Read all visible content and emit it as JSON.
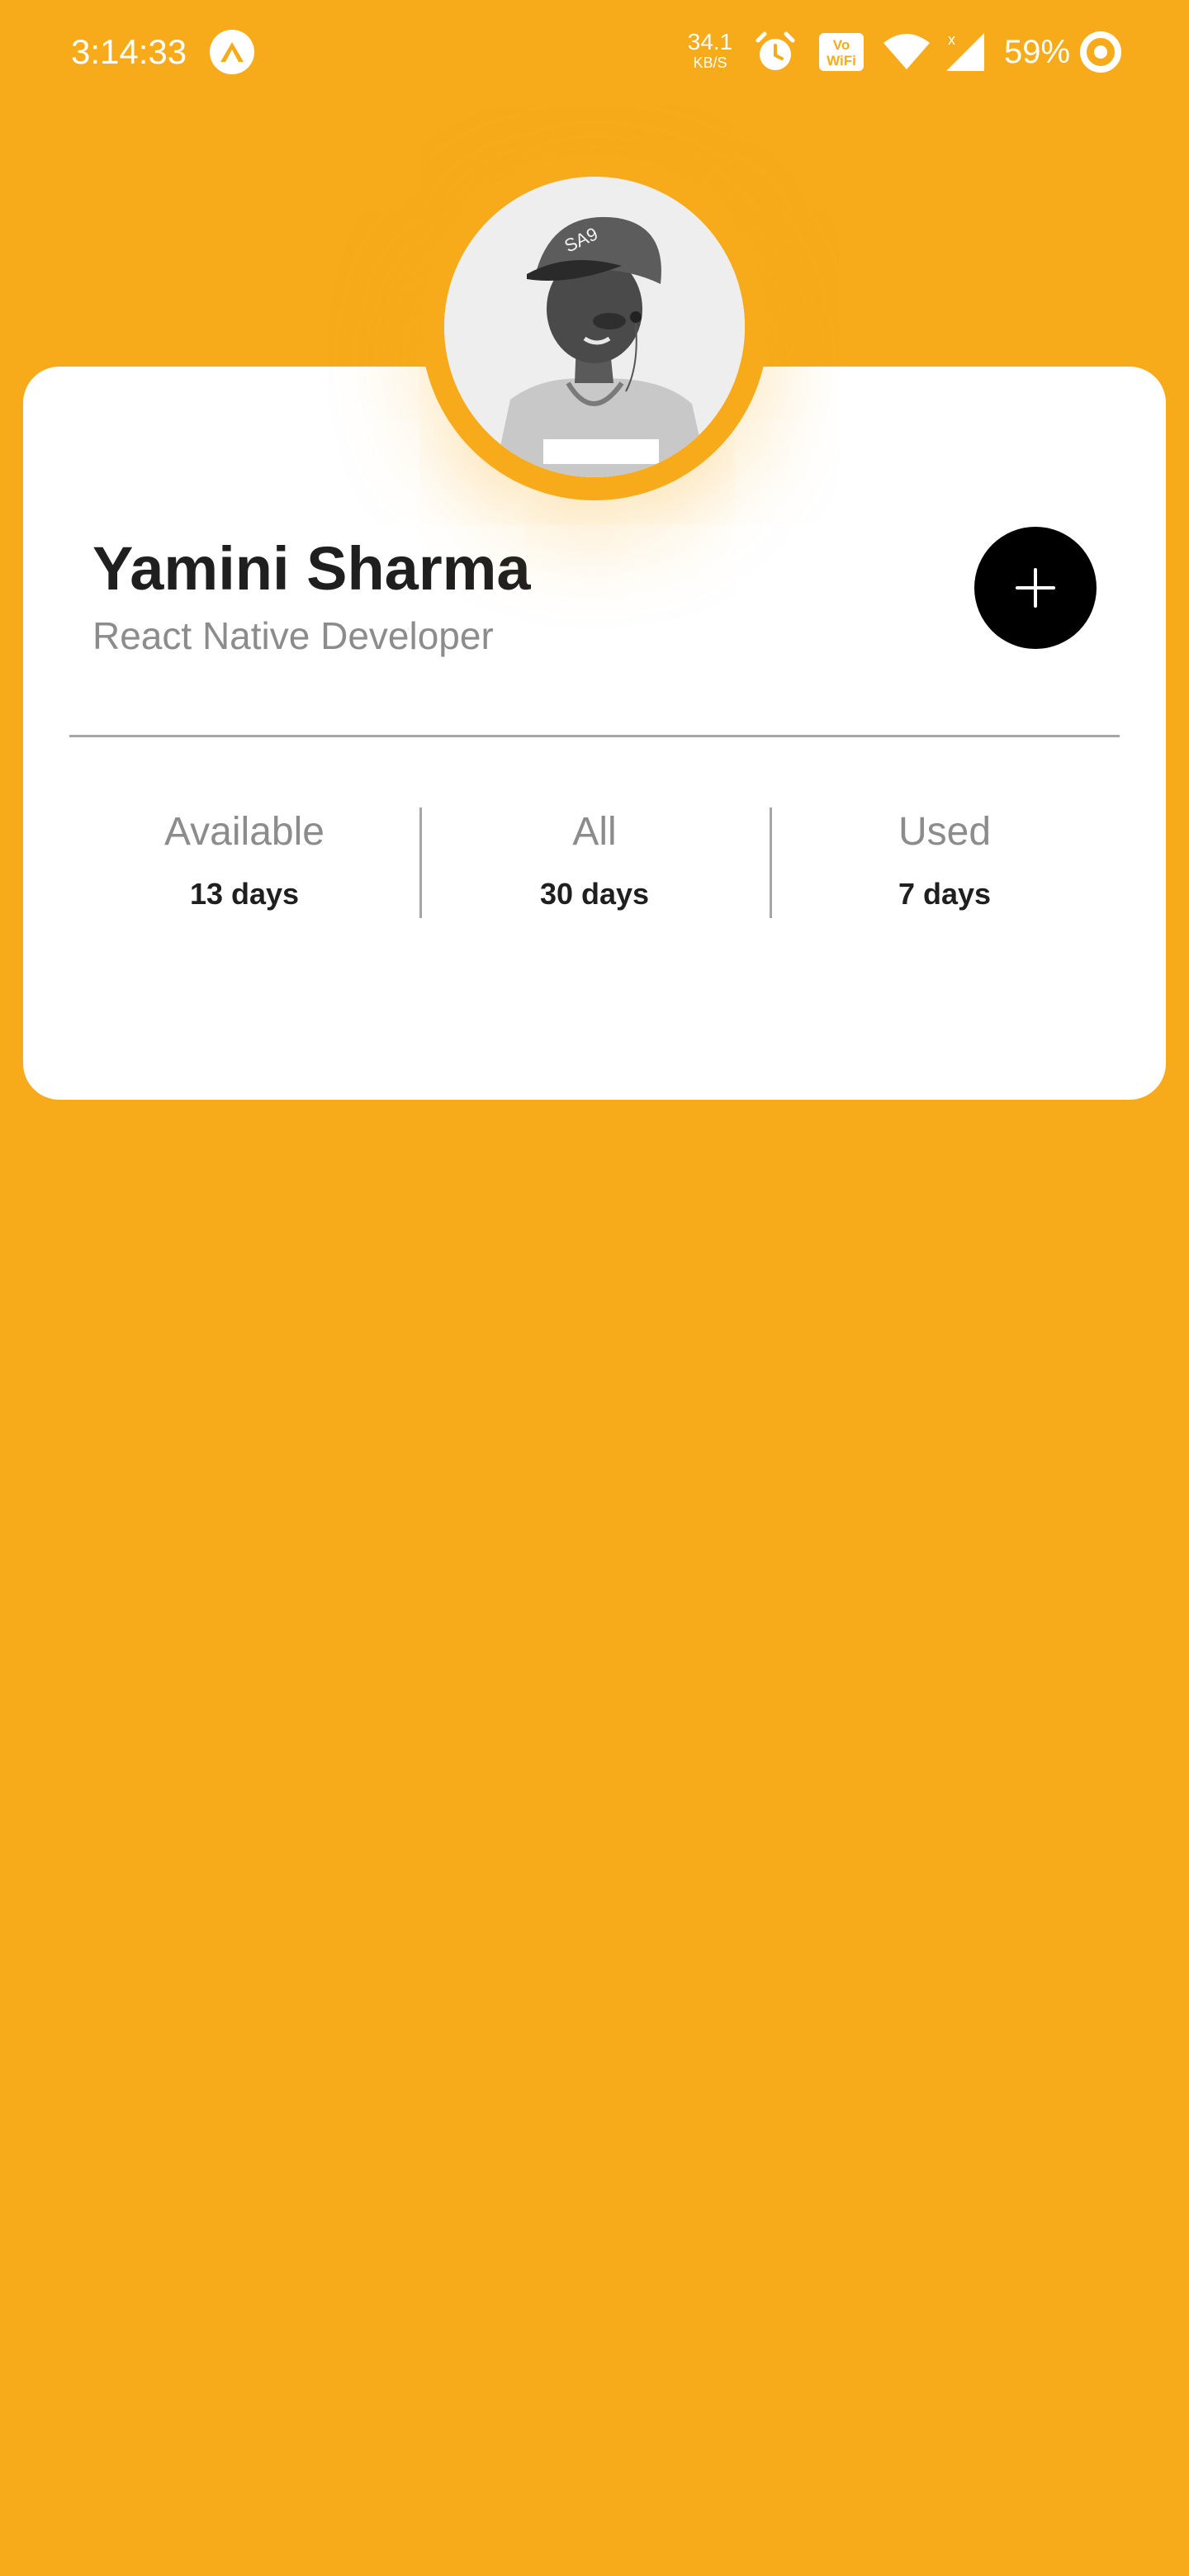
{
  "status_bar": {
    "time": "3:14:33",
    "net_speed_value": "34.1",
    "net_speed_unit": "KB/S",
    "battery": "59%",
    "icons": [
      "expo-icon",
      "alarm-icon",
      "volte-wifi-icon",
      "wifi-icon",
      "signal-icon",
      "battery-saver-icon"
    ]
  },
  "profile": {
    "name": "Yamini Sharma",
    "role": "React Native Developer",
    "add_button_icon": "plus-icon"
  },
  "stats": [
    {
      "label": "Available",
      "value": "13 days"
    },
    {
      "label": "All",
      "value": "30 days"
    },
    {
      "label": "Used",
      "value": "7 days"
    }
  ],
  "colors": {
    "background": "#F7AB1A",
    "card": "#FFFFFF",
    "add_button": "#000000",
    "name_text": "#1F1F1F",
    "muted_text": "#8C8C8C"
  }
}
